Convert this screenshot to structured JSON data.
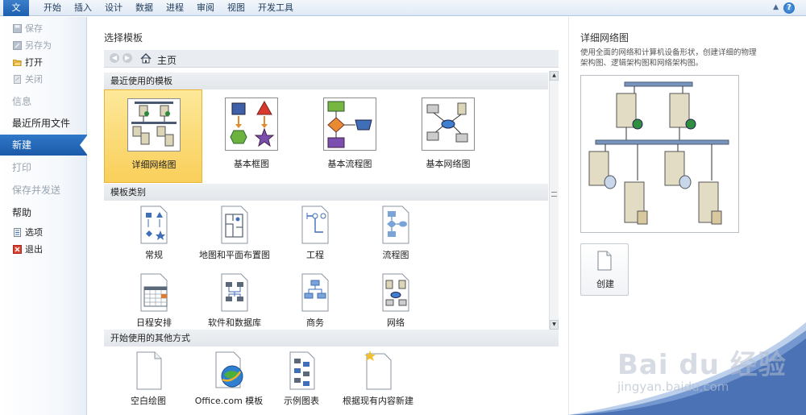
{
  "ribbon": {
    "tabs": [
      "文件",
      "开始",
      "插入",
      "设计",
      "数据",
      "进程",
      "审阅",
      "视图",
      "开发工具"
    ],
    "active_tab": "文件",
    "help": "?"
  },
  "nav": {
    "small_items": [
      {
        "label": "保存",
        "enabled": false,
        "icon": "save-icon"
      },
      {
        "label": "另存为",
        "enabled": false,
        "icon": "save-as-icon"
      },
      {
        "label": "打开",
        "enabled": true,
        "icon": "open-folder-icon"
      },
      {
        "label": "关闭",
        "enabled": false,
        "icon": "close-doc-icon"
      }
    ],
    "big_items": [
      {
        "label": "信息",
        "enabled": false
      },
      {
        "label": "最近所用文件",
        "enabled": true
      },
      {
        "label": "新建",
        "enabled": true,
        "active": true
      },
      {
        "label": "打印",
        "enabled": false
      },
      {
        "label": "保存并发送",
        "enabled": false
      },
      {
        "label": "帮助",
        "enabled": true
      }
    ],
    "bottom_items": [
      {
        "label": "选项",
        "icon": "options-icon"
      },
      {
        "label": "退出",
        "icon": "exit-icon"
      }
    ]
  },
  "main": {
    "title": "选择模板",
    "breadcrumb": {
      "home_label": "主页"
    },
    "recent_section": "模板类别",
    "recent_header": "最近使用的模板",
    "recent_templates": [
      {
        "label": "详细网络图",
        "selected": true
      },
      {
        "label": "基本框图",
        "selected": false
      },
      {
        "label": "基本流程图",
        "selected": false
      },
      {
        "label": "基本网络图",
        "selected": false
      }
    ],
    "categories_header": "模板类别",
    "categories": [
      {
        "label": "常规",
        "icon": "general-template-icon"
      },
      {
        "label": "地图和平面布置图",
        "icon": "maps-floorplans-icon"
      },
      {
        "label": "工程",
        "icon": "engineering-icon"
      },
      {
        "label": "流程图",
        "icon": "flowchart-icon"
      },
      {
        "label": "日程安排",
        "icon": "schedule-icon"
      },
      {
        "label": "软件和数据库",
        "icon": "software-database-icon"
      },
      {
        "label": "商务",
        "icon": "business-icon"
      },
      {
        "label": "网络",
        "icon": "network-icon"
      }
    ],
    "other_header": "开始使用的其他方式",
    "other_ways": [
      {
        "label": "空白绘图",
        "icon": "blank-drawing-icon"
      },
      {
        "label": "Office.com 模板",
        "icon": "office-com-icon"
      },
      {
        "label": "示例图表",
        "icon": "sample-diagrams-icon"
      },
      {
        "label": "根据现有内容新建",
        "icon": "new-from-existing-icon"
      }
    ]
  },
  "preview": {
    "title": "详细网络图",
    "description": "使用全面的网络和计算机设备形状，创建详细的物理架构图、逻辑架构图和网络架构图。",
    "create_label": "创建"
  },
  "watermark": {
    "brand": "Bai du 经验",
    "url": "jingyan.baidu.com"
  },
  "colors": {
    "accent": "#1b5fb0",
    "selected_tile": "#f9cf5a"
  }
}
